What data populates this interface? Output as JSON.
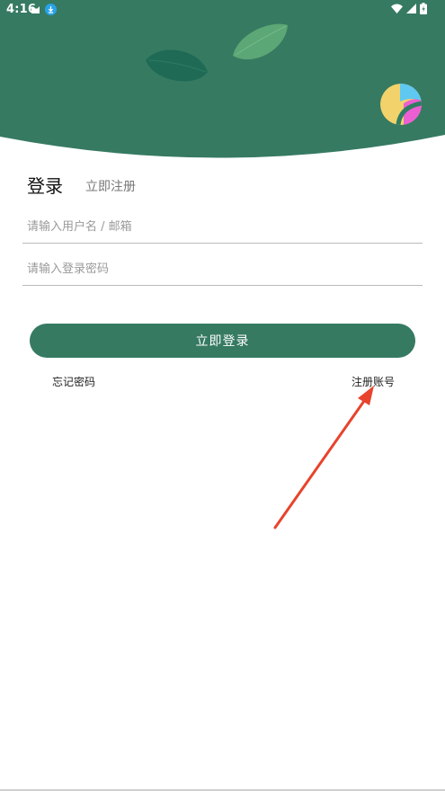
{
  "status_bar": {
    "time": "4:16"
  },
  "tabs": {
    "login": "登录",
    "register": "立即注册"
  },
  "form": {
    "username_placeholder": "请输入用户名 / 邮箱",
    "password_placeholder": "请输入登录密码",
    "username_value": "",
    "password_value": ""
  },
  "buttons": {
    "login": "立即登录"
  },
  "links": {
    "forgot_password": "忘记密码",
    "register_account": "注册账号"
  },
  "icons": {
    "status_left": [
      "cat-notification-icon",
      "download-notification-icon"
    ],
    "status_right": [
      "wifi-icon",
      "signal-icon",
      "battery-charging-icon"
    ]
  },
  "colors": {
    "primary": "#367a62",
    "leaf_dark": "#1f6a55",
    "leaf_light": "#5ba775",
    "annotation_arrow": "#e8432c"
  }
}
